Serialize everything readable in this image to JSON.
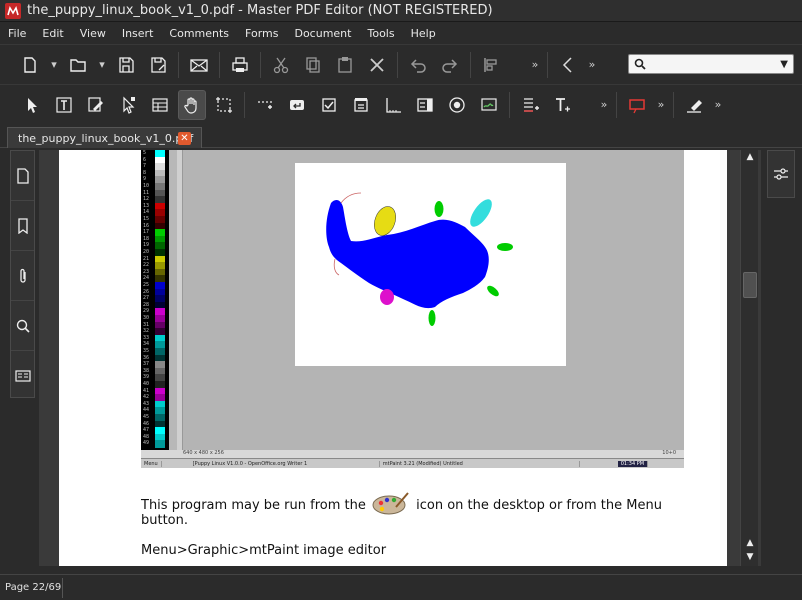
{
  "window": {
    "title": "the_puppy_linux_book_v1_0.pdf - Master PDF Editor (NOT REGISTERED)"
  },
  "menu": [
    "File",
    "Edit",
    "View",
    "Insert",
    "Comments",
    "Forms",
    "Document",
    "Tools",
    "Help"
  ],
  "toolbar1": {
    "buttons": [
      "new-file",
      "open-file",
      "save",
      "save-as",
      "email",
      "print",
      "cut",
      "copy",
      "paste",
      "delete",
      "undo",
      "redo",
      "align"
    ],
    "search_value": ""
  },
  "toolbar2": {
    "buttons": [
      "select",
      "text-edit",
      "edit-object",
      "edit-forms",
      "table",
      "hand",
      "snapshot",
      "link",
      "enter",
      "checkbox",
      "list",
      "measure",
      "field",
      "radio",
      "signature",
      "insert-text",
      "text-tool",
      "rect",
      "eraser"
    ]
  },
  "tab": {
    "label": "the_puppy_linux_book_v1_0.pdf"
  },
  "document": {
    "embedded_screenshot": {
      "status_left": "640 x 480 x 256",
      "status_right": "10+0",
      "taskbar": [
        "Menu",
        "[Puppy Linux V1.0.0 - OpenOffice.org Writer 1",
        "mtPaint 3.21 (Modified) Untitled",
        "01:34 PM"
      ],
      "palette_numbers": [
        "5",
        "6",
        "7",
        "8",
        "9",
        "10",
        "11",
        "12",
        "13",
        "14",
        "15",
        "16",
        "17",
        "18",
        "19",
        "20",
        "21",
        "22",
        "23",
        "24",
        "25",
        "26",
        "27",
        "28",
        "29",
        "30",
        "31",
        "32",
        "33",
        "34",
        "35",
        "36",
        "37",
        "38",
        "39",
        "40",
        "41",
        "42",
        "43",
        "44",
        "45",
        "46",
        "47",
        "48",
        "49"
      ]
    },
    "paragraph1_a": "This program may be run from the",
    "paragraph1_b": "icon on the desktop or from the Menu",
    "paragraph1_c": "button.",
    "paragraph2": "Menu>Graphic>mtPaint image editor"
  },
  "status": {
    "page": "Page 22/69"
  },
  "colors": {
    "accent_close": "#e15a2e",
    "app_icon": "#c62828",
    "paint_blue": "#0000ff"
  }
}
